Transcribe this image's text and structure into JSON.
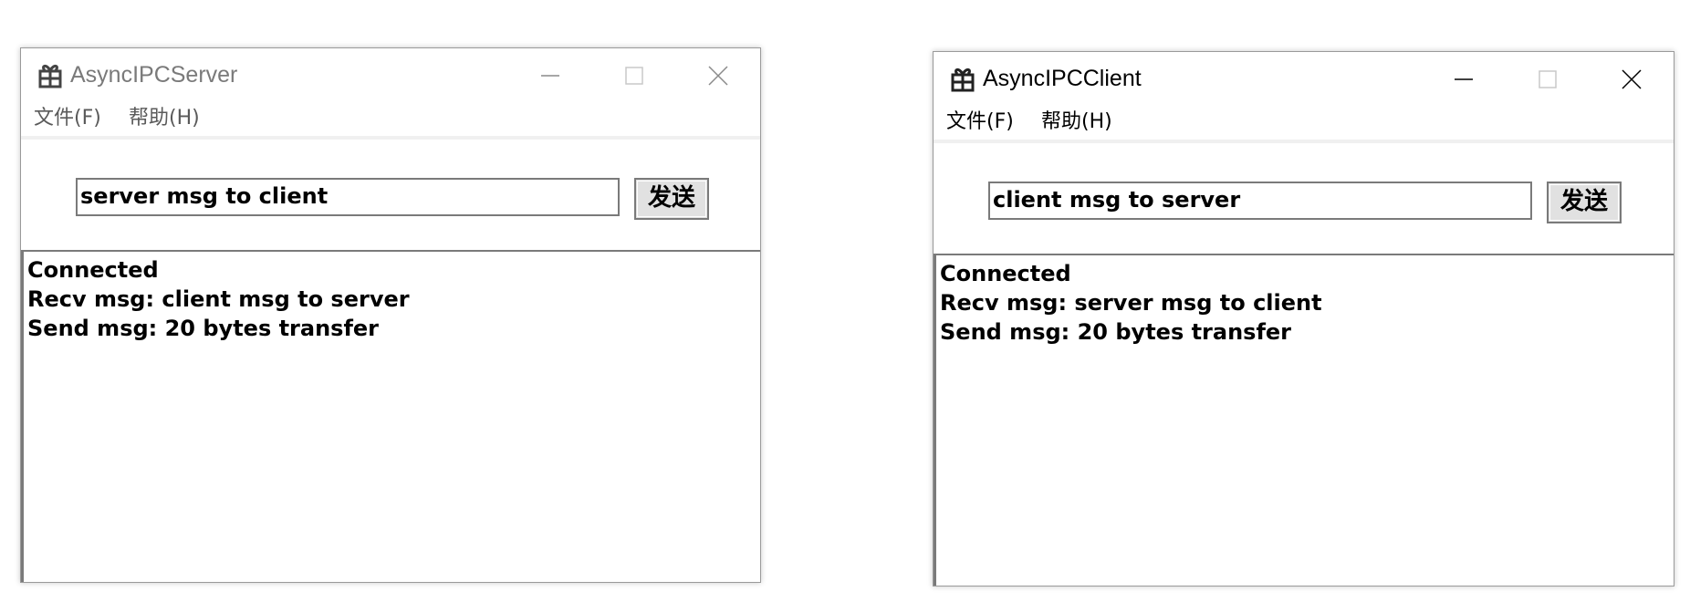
{
  "server": {
    "title": "AsyncIPCServer",
    "state": "inactive",
    "menu": {
      "file": "文件(F)",
      "help": "帮助(H)"
    },
    "input_value": "server msg to client",
    "send_label": "发送",
    "log": [
      "Connected",
      "Recv msg: client msg to server",
      "Send msg: 20 bytes transfer"
    ]
  },
  "client": {
    "title": "AsyncIPCClient",
    "state": "active",
    "menu": {
      "file": "文件(F)",
      "help": "帮助(H)"
    },
    "input_value": "client msg to server",
    "send_label": "发送",
    "log": [
      "Connected",
      "Recv msg: server msg to client",
      "Send msg: 20 bytes transfer"
    ]
  },
  "icons": {
    "app": "gift-box-icon",
    "minimize": "minimize-icon",
    "maximize": "maximize-icon",
    "close": "close-icon"
  },
  "colors": {
    "inactive_title": "#7a7a7a",
    "active_title": "#000000",
    "menubar_separator": "#f0f0f0",
    "button_face": "#e1e1e1",
    "border": "#7a7a7a"
  }
}
